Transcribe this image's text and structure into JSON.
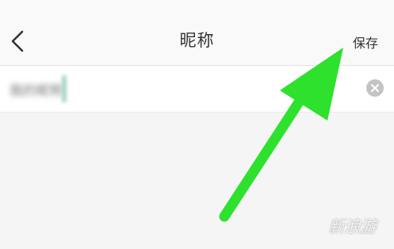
{
  "header": {
    "back_icon": "chevron-left-icon",
    "title": "昵称",
    "save_label": "保存"
  },
  "input": {
    "value": "我的昵称",
    "clear_icon": "clear-circle-icon"
  },
  "overlay": {
    "arrow_color": "#2de12d"
  },
  "watermark": {
    "text": "新浪游"
  }
}
